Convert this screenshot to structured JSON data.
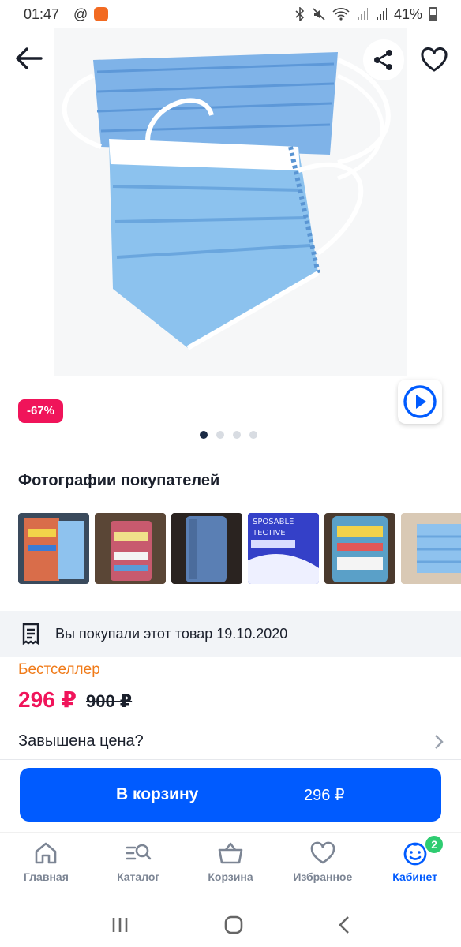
{
  "status_bar": {
    "time": "01:47",
    "at_symbol": "@",
    "battery": "41%"
  },
  "product": {
    "discount_badge": "-67%",
    "gallery_pages": 4,
    "gallery_current": 1
  },
  "buyer_photos": {
    "title": "Фотографии покупателей",
    "count_visible": 6
  },
  "purchase_note": "Вы покупали этот товар 19.10.2020",
  "badge_bestseller": "Бестселлер",
  "price": {
    "current": "296 ₽",
    "old": "900 ₽"
  },
  "price_question": "Завышена цена?",
  "cart_button": {
    "label": "В корзину",
    "price": "296 ₽"
  },
  "tabbar": {
    "tabs": [
      {
        "label": "Главная",
        "icon": "home-icon"
      },
      {
        "label": "Каталог",
        "icon": "catalog-search-icon"
      },
      {
        "label": "Корзина",
        "icon": "basket-icon"
      },
      {
        "label": "Избранное",
        "icon": "heart-icon"
      },
      {
        "label": "Кабинет",
        "icon": "profile-face-icon",
        "badge": "2"
      }
    ],
    "active_index": 4
  },
  "colors": {
    "accent": "#005bff",
    "sale": "#f0145a",
    "bestseller": "#f07a18",
    "badge_green": "#2ecc71"
  }
}
